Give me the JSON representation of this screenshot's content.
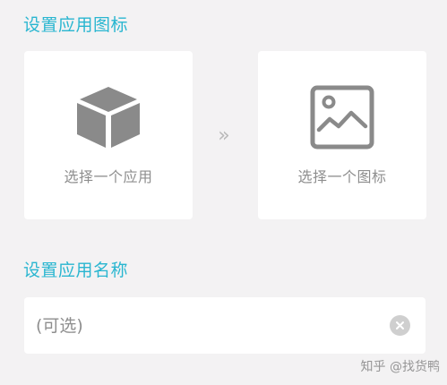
{
  "sections": {
    "icon_title": "设置应用图标",
    "name_title": "设置应用名称"
  },
  "app_card": {
    "label": "选择一个应用",
    "icon": "cube-icon"
  },
  "icon_card": {
    "label": "选择一个图标",
    "icon": "image-icon"
  },
  "arrow": {
    "glyph": "»",
    "icon": "double-chevron-right-icon"
  },
  "name_input": {
    "placeholder": "(可选)",
    "value": "",
    "clear_icon": "clear-icon"
  },
  "watermark": "知乎 @找货鸭",
  "colors": {
    "accent": "#29b6d0",
    "background": "#f3f2f3",
    "card": "#ffffff",
    "icon_gray": "#8a8a8a",
    "label_gray": "#8e8e8e"
  }
}
